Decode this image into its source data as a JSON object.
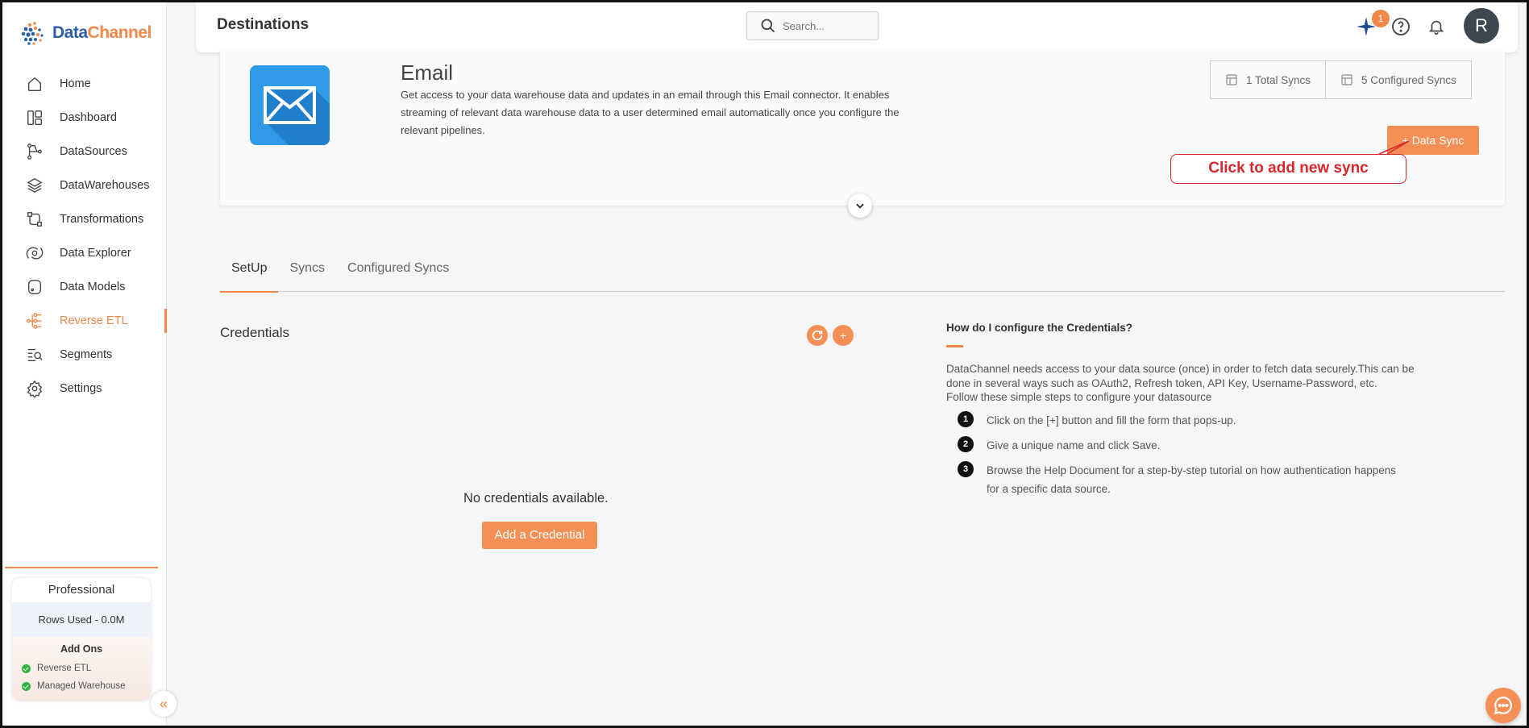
{
  "brand": {
    "name_part1": "Data",
    "name_part2": "Channel",
    "primary_color": "#2b5fa8",
    "accent_color": "#f2874a"
  },
  "sidebar": {
    "items": [
      {
        "label": "Home",
        "icon": "home-icon"
      },
      {
        "label": "Dashboard",
        "icon": "dashboard-icon"
      },
      {
        "label": "DataSources",
        "icon": "datasources-icon"
      },
      {
        "label": "DataWarehouses",
        "icon": "layers-icon"
      },
      {
        "label": "Transformations",
        "icon": "transformations-icon"
      },
      {
        "label": "Data Explorer",
        "icon": "explorer-icon"
      },
      {
        "label": "Data Models",
        "icon": "models-icon"
      },
      {
        "label": "Reverse ETL",
        "icon": "reverse-etl-icon",
        "active": true
      },
      {
        "label": "Segments",
        "icon": "segments-icon"
      },
      {
        "label": "Settings",
        "icon": "gear-icon"
      }
    ],
    "plan": {
      "name": "Professional",
      "rows_used": "Rows Used - 0.0M",
      "addons_title": "Add Ons",
      "addons": [
        "Reverse ETL",
        "Managed Warehouse"
      ]
    }
  },
  "header": {
    "title": "Destinations",
    "search_placeholder": "Search...",
    "notification_badge": "1",
    "avatar_initial": "R"
  },
  "connector": {
    "name": "Email",
    "description": "Get access to your data warehouse data and updates in an email through this Email connector. It enables streaming of relevant data warehouse data to a user determined email automatically once you configure the relevant pipelines.",
    "total_syncs": "1 Total Syncs",
    "configured_syncs": "5 Configured Syncs",
    "data_sync_button": "+ Data Sync",
    "callout": "Click to add new sync"
  },
  "tabs": [
    {
      "label": "SetUp",
      "active": true
    },
    {
      "label": "Syncs",
      "active": false
    },
    {
      "label": "Configured Syncs",
      "active": false
    }
  ],
  "credentials": {
    "title": "Credentials",
    "empty_text": "No credentials available.",
    "add_button": "Add a Credential"
  },
  "help": {
    "title": "How do I configure the Credentials?",
    "intro": "DataChannel needs access to your data source (once) in order to fetch data securely.This can be done in several ways such as OAuth2, Refresh token, API Key, Username-Password, etc.",
    "follow": "Follow these simple steps to configure your datasource",
    "steps": [
      {
        "num": "1",
        "text": "Click on the [+] button and fill the form that pops-up."
      },
      {
        "num": "2",
        "text": "Give a unique name and click Save."
      },
      {
        "num": "3",
        "text": "Browse the Help Document for a step-by-step tutorial on how authentication happens for a specific data source."
      }
    ]
  }
}
